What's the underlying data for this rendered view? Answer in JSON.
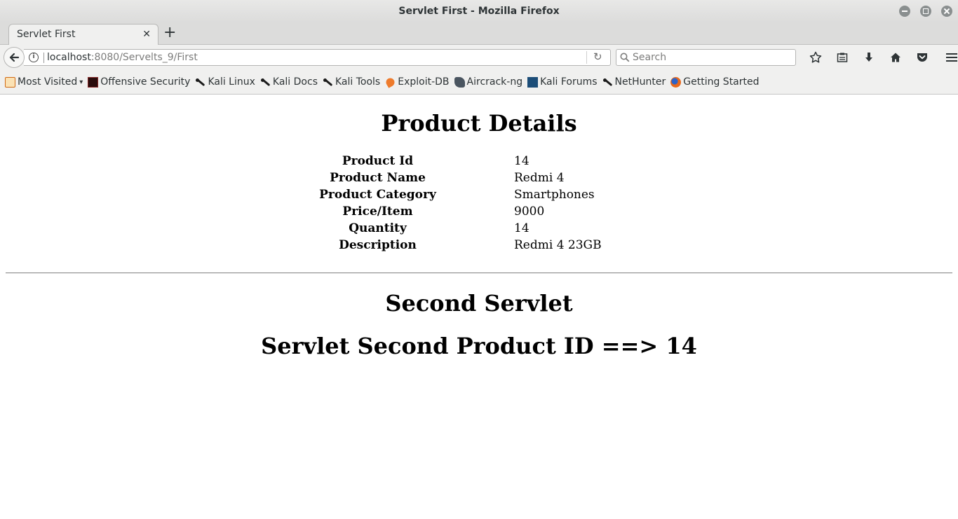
{
  "window": {
    "title": "Servlet First - Mozilla Firefox"
  },
  "tabs": [
    {
      "label": "Servlet First"
    }
  ],
  "navbar": {
    "url_host": "localhost",
    "url_rest": ":8080/Servelts_9/First",
    "search_placeholder": "Search"
  },
  "bookmarks": [
    {
      "label": "Most Visited",
      "icon": "folder-icon"
    },
    {
      "label": "Offensive Security",
      "icon": "offsec-icon"
    },
    {
      "label": "Kali Linux",
      "icon": "kali-icon"
    },
    {
      "label": "Kali Docs",
      "icon": "kali-icon"
    },
    {
      "label": "Kali Tools",
      "icon": "kali-icon"
    },
    {
      "label": "Exploit-DB",
      "icon": "exploit-db-icon"
    },
    {
      "label": "Aircrack-ng",
      "icon": "aircrack-icon"
    },
    {
      "label": "Kali Forums",
      "icon": "kali-forums-icon"
    },
    {
      "label": "NetHunter",
      "icon": "kali-icon"
    },
    {
      "label": "Getting Started",
      "icon": "firefox-icon"
    }
  ],
  "page": {
    "heading": "Product Details",
    "rows": [
      {
        "label": "Product Id",
        "value": "14"
      },
      {
        "label": "Product Name",
        "value": "Redmi 4"
      },
      {
        "label": "Product Category",
        "value": "Smartphones"
      },
      {
        "label": "Price/Item",
        "value": "9000"
      },
      {
        "label": "Quantity",
        "value": "14"
      },
      {
        "label": "Description",
        "value": "Redmi 4 23GB"
      }
    ],
    "second_heading": "Second Servlet",
    "product_id_line": "Servlet Second Product ID ==> 14"
  }
}
